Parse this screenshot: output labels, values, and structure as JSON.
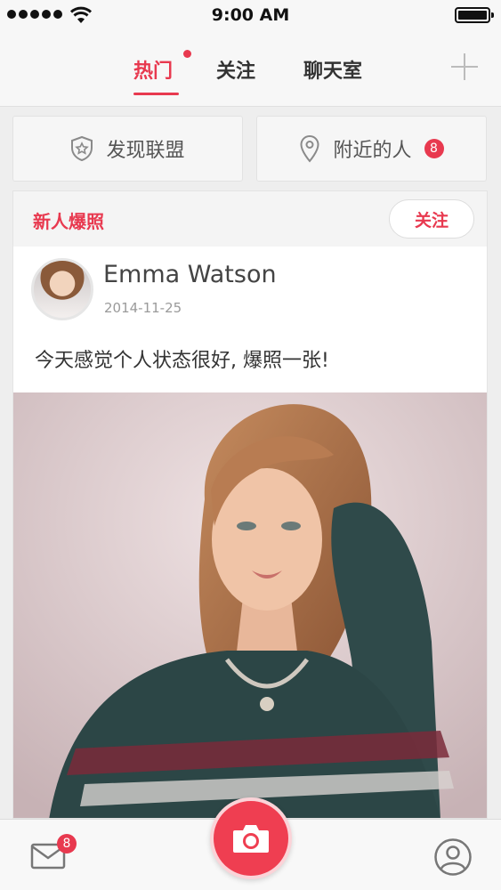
{
  "status_bar": {
    "time": "9:00 AM"
  },
  "top_nav": {
    "tabs": [
      {
        "label": "热门",
        "active": true
      },
      {
        "label": "关注",
        "active": false
      },
      {
        "label": "聊天室",
        "active": false
      }
    ]
  },
  "quick_actions": {
    "discover": {
      "label": "发现联盟",
      "icon": "shield-star-icon"
    },
    "nearby": {
      "label": "附近的人",
      "icon": "location-pin-icon",
      "badge": "8"
    }
  },
  "card": {
    "title": "新人爆照",
    "follow_label": "关注",
    "post": {
      "user_name": "Emma Watson",
      "date": "2014-11-25",
      "text": "今天感觉个人状态很好, 爆照一张!"
    }
  },
  "bottom_bar": {
    "mail_badge": "8",
    "mail_icon": "mail-icon",
    "camera_icon": "camera-icon",
    "profile_icon": "user-icon"
  },
  "colors": {
    "accent": "#e8394f",
    "camera": "#ef3e51",
    "background": "#eeeeee"
  }
}
